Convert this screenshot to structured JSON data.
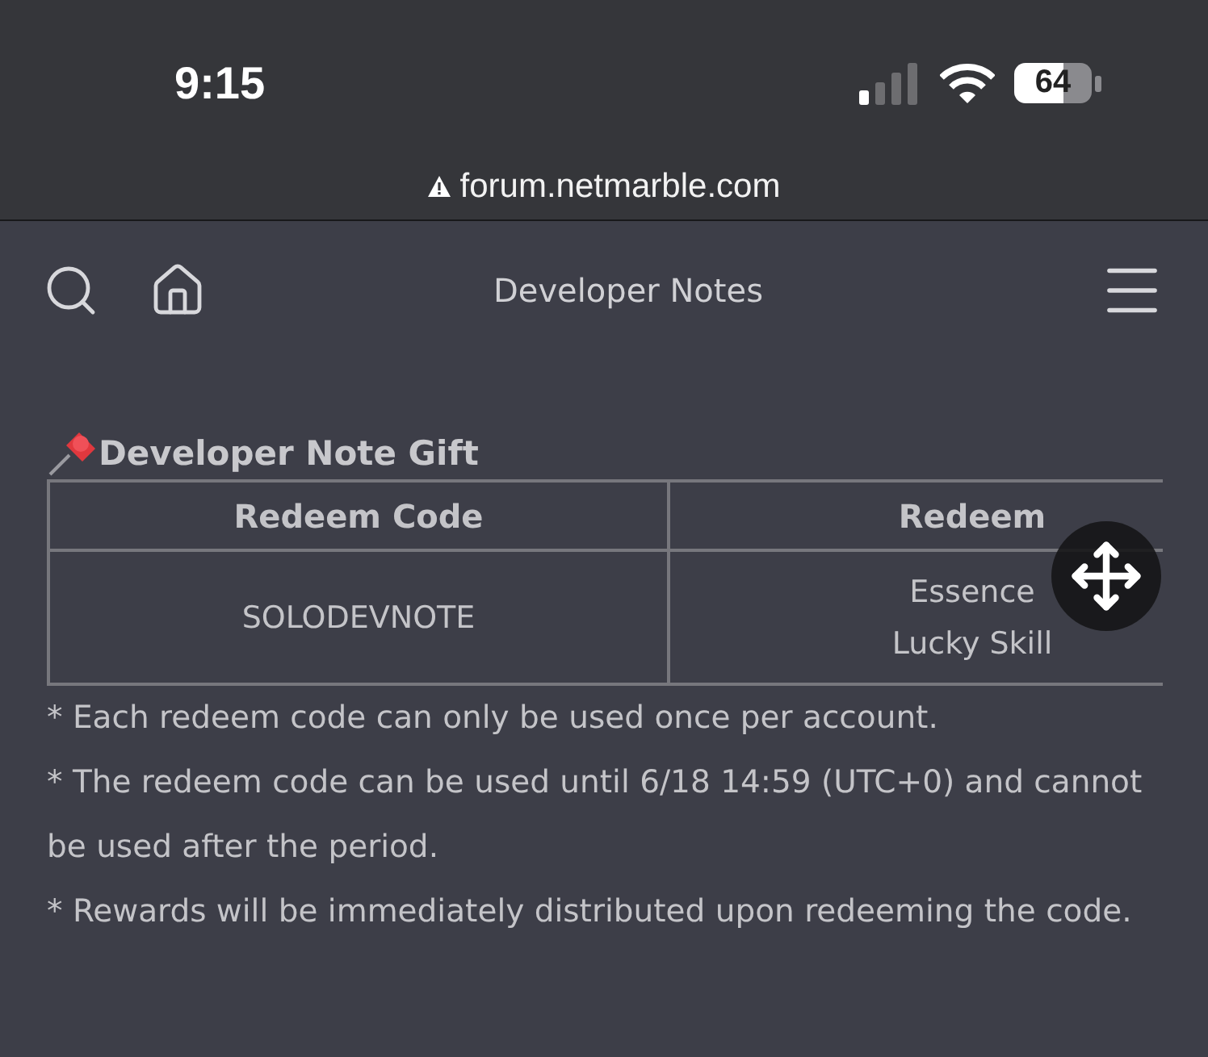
{
  "status_bar": {
    "time": "9:15",
    "battery": "64"
  },
  "address_bar": {
    "url": "forum.netmarble.com"
  },
  "nav_bar": {
    "title": "Developer Notes"
  },
  "post": {
    "heading": "Developer Note Gift",
    "table": {
      "columns": [
        "Redeem Code",
        "Redeem"
      ],
      "rows": [
        {
          "code": "SOLODEVNOTE",
          "rewards": [
            "Essence",
            "Lucky Skill"
          ]
        }
      ]
    },
    "notes": [
      "* Each redeem code can only be used once per account.",
      "* The redeem code can be used until 6/18 14:59 (UTC+0) and cannot be used after the period.",
      "* Rewards will be immediately distributed upon redeeming the code."
    ]
  }
}
